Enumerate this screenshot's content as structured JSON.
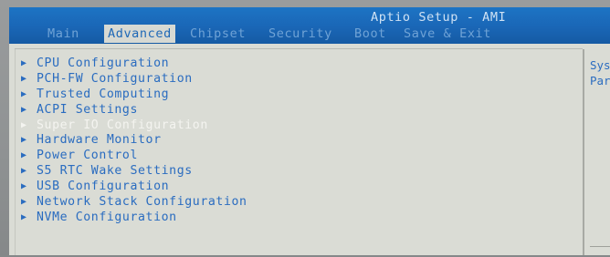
{
  "header": {
    "title": "Aptio Setup - AMI",
    "tabs": [
      {
        "label": "Main"
      },
      {
        "label": "Advanced"
      },
      {
        "label": "Chipset"
      },
      {
        "label": "Security"
      },
      {
        "label": "Boot"
      },
      {
        "label": "Save & Exit"
      }
    ],
    "active_tab": "Advanced"
  },
  "menu": {
    "items": [
      {
        "label": "CPU Configuration"
      },
      {
        "label": "PCH-FW Configuration"
      },
      {
        "label": "Trusted Computing"
      },
      {
        "label": "ACPI Settings"
      },
      {
        "label": "Super IO Configuration"
      },
      {
        "label": "Hardware Monitor"
      },
      {
        "label": "Power Control"
      },
      {
        "label": "S5 RTC Wake Settings"
      },
      {
        "label": "USB Configuration"
      },
      {
        "label": "Network Stack Configuration"
      },
      {
        "label": "NVMe Configuration"
      }
    ],
    "selected_item": "Super IO Configuration",
    "submenu_marker": "▶"
  },
  "help_panel": {
    "line1": "Sys",
    "line2": "Par"
  },
  "colors": {
    "header_blue": "#1a66b6",
    "menu_text_blue": "#2a6cc0",
    "background": "#dadcd5",
    "selected_text": "#f4f4f0"
  }
}
